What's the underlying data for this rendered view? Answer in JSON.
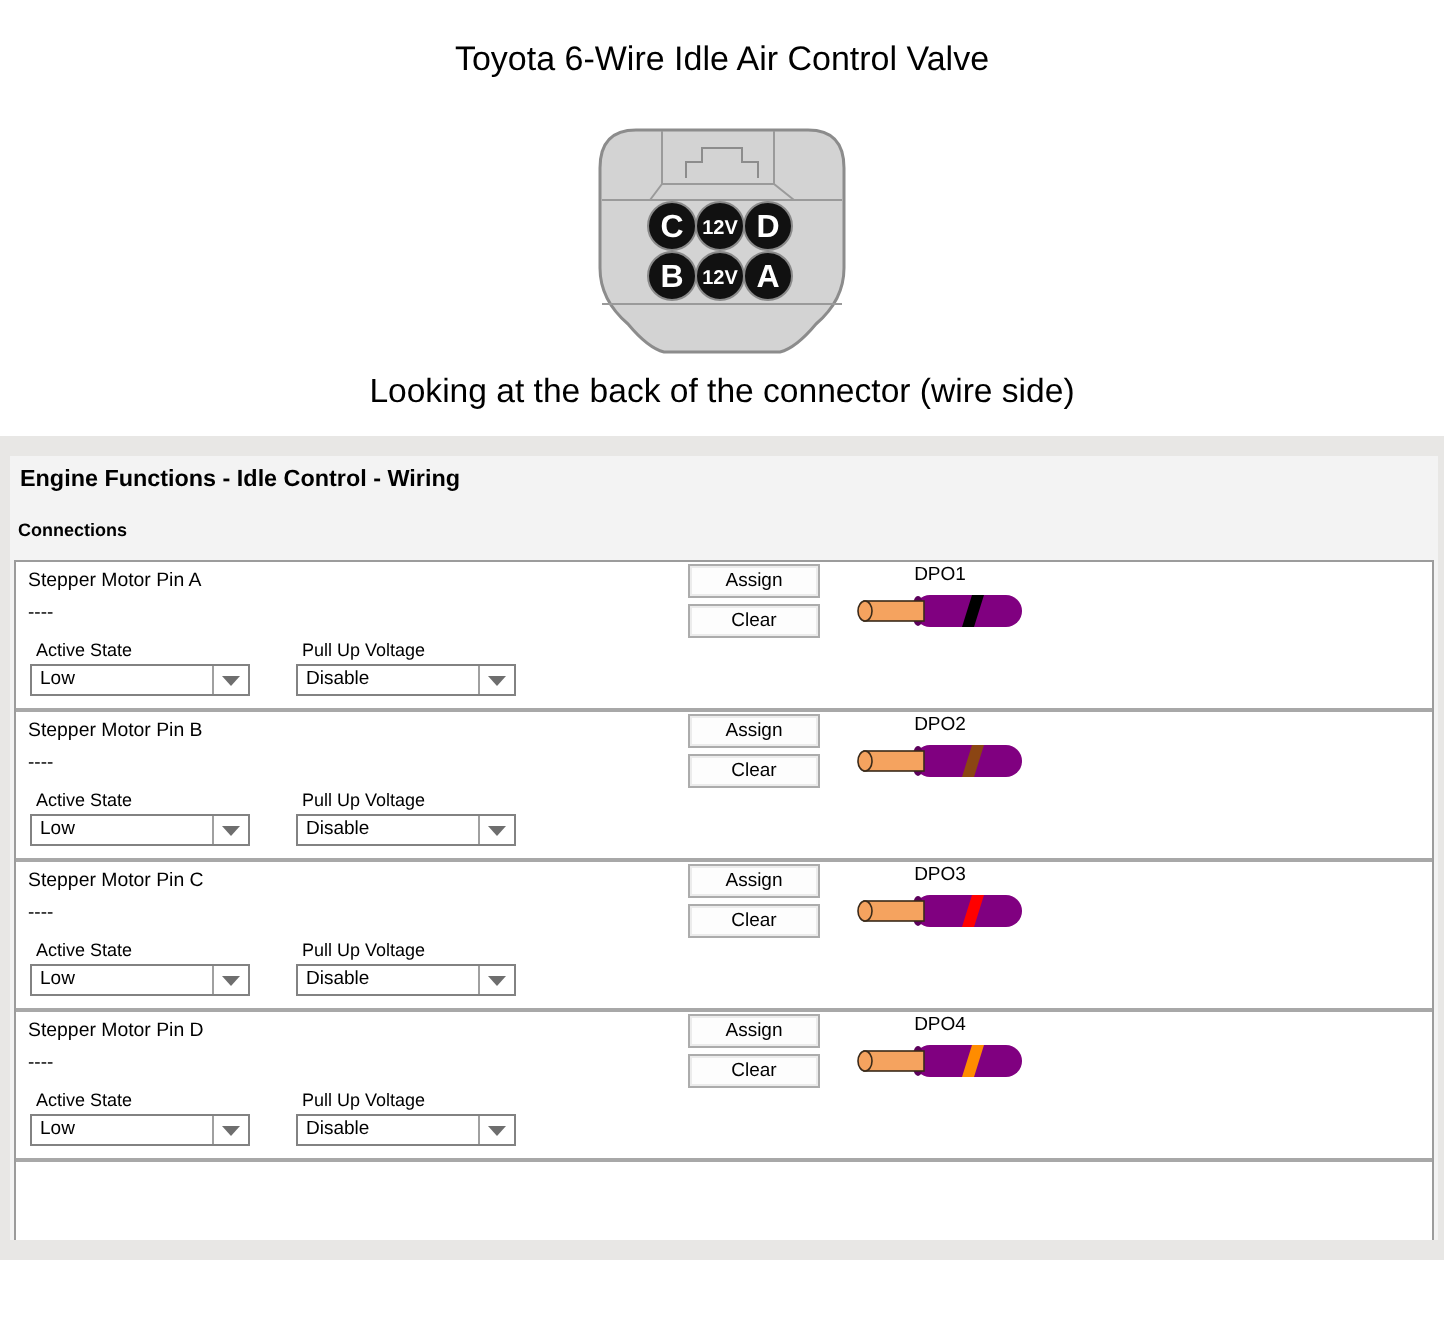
{
  "header": {
    "title": "Toyota 6-Wire Idle Air Control Valve",
    "connector": {
      "pins": [
        {
          "label": "C"
        },
        {
          "label": "12V"
        },
        {
          "label": "D"
        },
        {
          "label": "B"
        },
        {
          "label": "12V"
        },
        {
          "label": "A"
        }
      ]
    },
    "caption": "Looking at the back of the connector (wire side)"
  },
  "panel": {
    "title": "Engine Functions - Idle Control - Wiring",
    "section": "Connections",
    "connections": [
      {
        "name": "Stepper Motor Pin A",
        "value": "----",
        "fields": [
          {
            "label": "Active State",
            "value": "Low"
          },
          {
            "label": "Pull Up Voltage",
            "value": "Disable"
          }
        ],
        "buttons": [
          "Assign",
          "Clear"
        ],
        "output": "DPO1",
        "color": "#000000"
      },
      {
        "name": "Stepper Motor Pin B",
        "value": "----",
        "fields": [
          {
            "label": "Active State",
            "value": "Low"
          },
          {
            "label": "Pull Up Voltage",
            "value": "Disable"
          }
        ],
        "buttons": [
          "Assign",
          "Clear"
        ],
        "output": "DPO2",
        "color": "#8b4513"
      },
      {
        "name": "Stepper Motor Pin C",
        "value": "----",
        "fields": [
          {
            "label": "Active State",
            "value": "Low"
          },
          {
            "label": "Pull Up Voltage",
            "value": "Disable"
          }
        ],
        "buttons": [
          "Assign",
          "Clear"
        ],
        "output": "DPO3",
        "color": "#ff0000"
      },
      {
        "name": "Stepper Motor Pin D",
        "value": "----",
        "fields": [
          {
            "label": "Active State",
            "value": "Low"
          },
          {
            "label": "Pull Up Voltage",
            "value": "Disable"
          }
        ],
        "buttons": [
          "Assign",
          "Clear"
        ],
        "output": "DPO4",
        "color": "#ff8c00"
      }
    ]
  }
}
